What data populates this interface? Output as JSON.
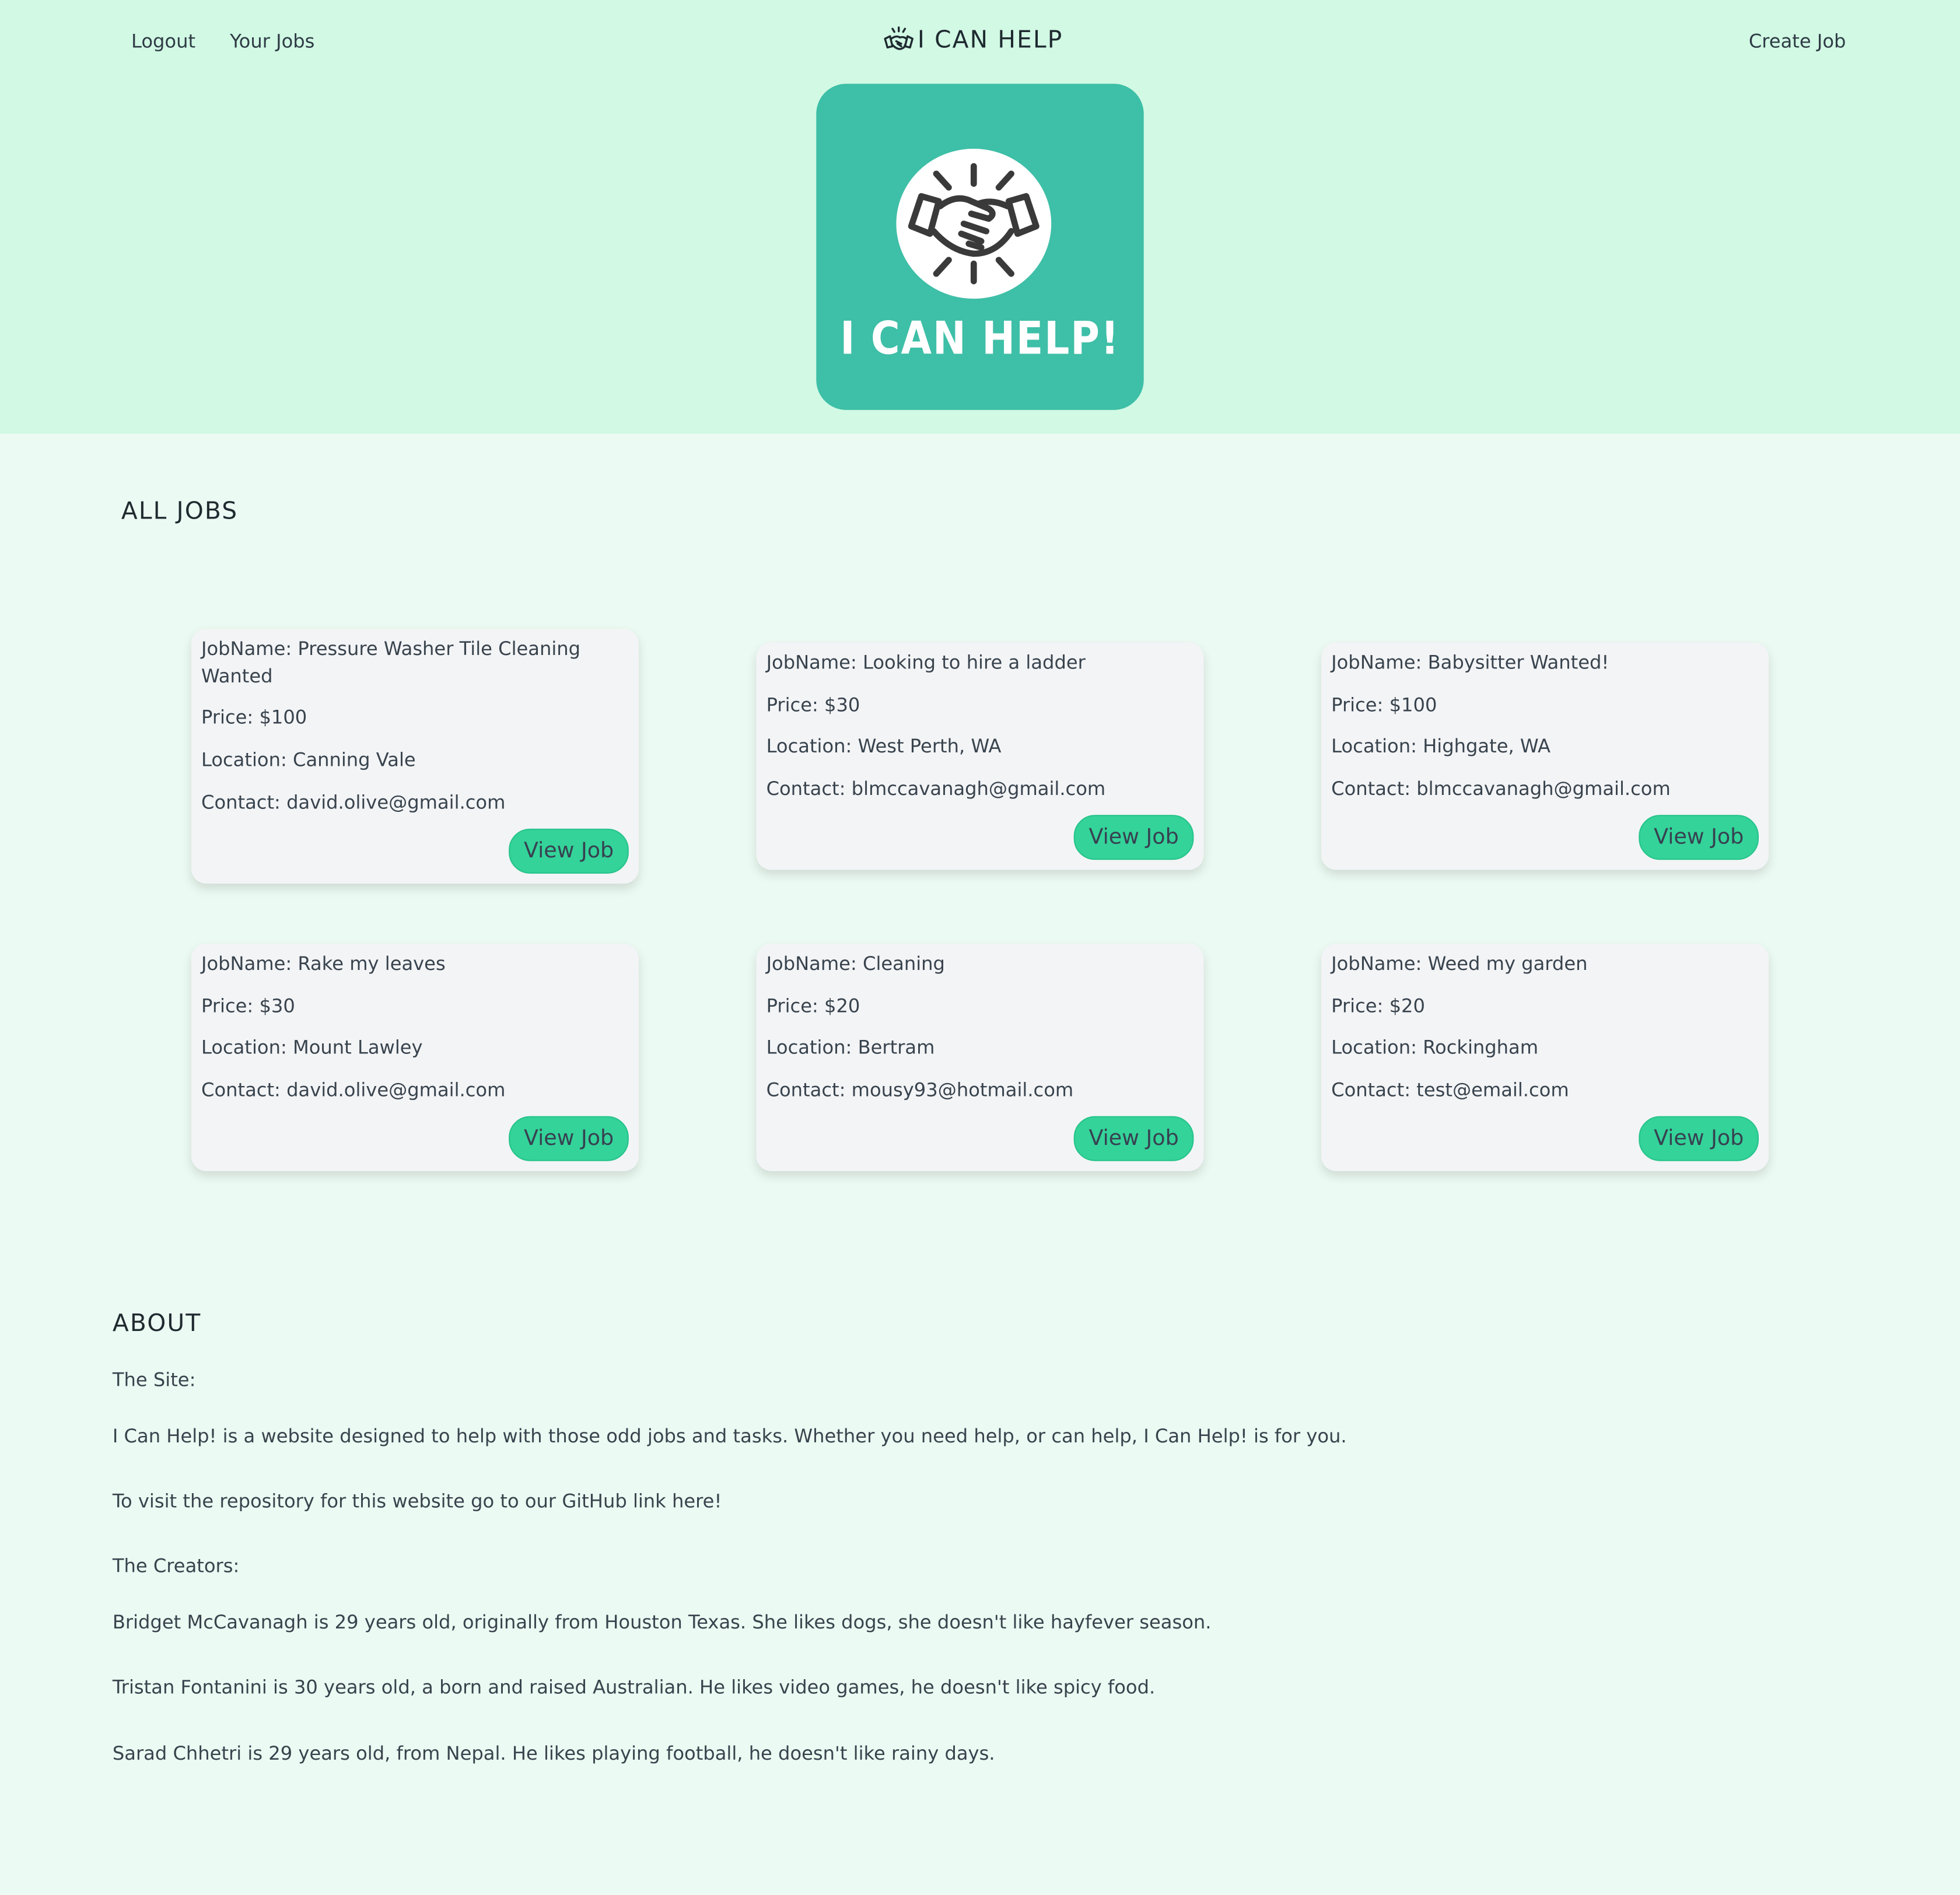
{
  "nav": {
    "logout": "Logout",
    "your_jobs": "Your Jobs",
    "brand": "I CAN HELP",
    "create_job": "Create Job"
  },
  "logo": {
    "text": "I CAN HELP!"
  },
  "jobs_section": {
    "title": "ALL JOBS",
    "view_label": "View Job",
    "jobs": [
      {
        "name": "JobName: Pressure Washer Tile Cleaning Wanted",
        "price": "Price: $100",
        "location": "Location: Canning Vale",
        "contact": "Contact: david.olive@gmail.com"
      },
      {
        "name": "JobName: Looking to hire a ladder",
        "price": "Price: $30",
        "location": "Location: West Perth, WA",
        "contact": "Contact: blmccavanagh@gmail.com"
      },
      {
        "name": "JobName: Babysitter Wanted!",
        "price": "Price: $100",
        "location": "Location: Highgate, WA",
        "contact": "Contact: blmccavanagh@gmail.com"
      },
      {
        "name": "JobName: Rake my leaves",
        "price": "Price: $30",
        "location": "Location: Mount Lawley",
        "contact": "Contact: david.olive@gmail.com"
      },
      {
        "name": "JobName: Cleaning",
        "price": "Price: $20",
        "location": "Location: Bertram",
        "contact": "Contact: mousy93@hotmail.com"
      },
      {
        "name": "JobName: Weed my garden",
        "price": "Price: $20",
        "location": "Location: Rockingham",
        "contact": "Contact: test@email.com"
      }
    ]
  },
  "about": {
    "title": "ABOUT",
    "site_heading": "The Site:",
    "site_desc": "I Can Help! is a website designed to help with those odd jobs and tasks. Whether you need help, or can help, I Can Help! is for you.",
    "repo_text": "To visit the repository for this website go to our GitHub link here!",
    "creators_heading": "The Creators:",
    "creators": [
      "Bridget McCavanagh is 29 years old, originally from Houston Texas. She likes dogs, she doesn't like hayfever season.",
      "Tristan Fontanini is 30 years old, a born and raised Australian. He likes video games, he doesn't like spicy food.",
      "Sarad Chhetri is 29 years old, from Nepal. He likes playing football, he doesn't like rainy days."
    ]
  }
}
